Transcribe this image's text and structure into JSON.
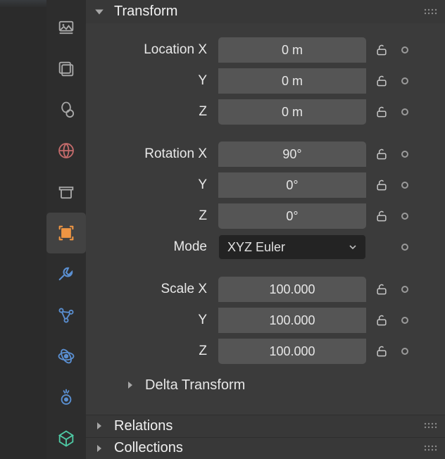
{
  "section": {
    "transform": {
      "title": "Transform",
      "location": {
        "title": "Location",
        "x_label": "X",
        "y_label": "Y",
        "z_label": "Z",
        "x": "0 m",
        "y": "0 m",
        "z": "0 m"
      },
      "rotation": {
        "title": "Rotation",
        "x_label": "X",
        "y_label": "Y",
        "z_label": "Z",
        "x": "90°",
        "y": "0°",
        "z": "0°"
      },
      "mode": {
        "label": "Mode",
        "value": "XYZ Euler"
      },
      "scale": {
        "title": "Scale",
        "x_label": "X",
        "y_label": "Y",
        "z_label": "Z",
        "x": "100.000",
        "y": "100.000",
        "z": "100.000"
      },
      "delta_title": "Delta Transform"
    },
    "relations_title": "Relations",
    "collections_title": "Collections"
  }
}
